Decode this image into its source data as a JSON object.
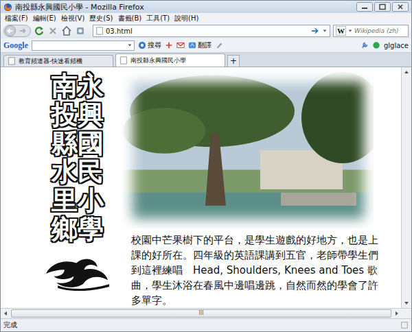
{
  "window": {
    "title": "南投縣永興國民小學 - Mozilla Firefox"
  },
  "menu": [
    "檔案(F)",
    "編輯(E)",
    "檢視(V)",
    "歷史(S)",
    "書籤(B)",
    "工具(T)",
    "說明(H)"
  ],
  "navigation": {
    "address": "03.html",
    "search_engine": "W",
    "search_placeholder": "Wikipedia (zh)"
  },
  "google_toolbar": {
    "logo": "Google",
    "search_button": "搜尋",
    "translate_button": "翻譯",
    "account": "glglace"
  },
  "tabs": [
    {
      "label": "教育頻道器-快速看頻機",
      "selected": false
    },
    {
      "label": "南投縣永興國民小學",
      "selected": true
    }
  ],
  "new_tab": "+",
  "page": {
    "title_columns": [
      "永興國民小學",
      "南投縣水里鄉"
    ],
    "paragraph": "校園中芒果樹下的平台，是學生遊戲的好地方，也是上課的好所在。四年級的英語課講到五官，老師帶學生們到這裡練唱　Head, Shoulders, Knees and Toes 歌曲，學生沐浴在春風中邊唱邊跳，自然而然的學會了許多單字。"
  },
  "scrollbar": {
    "grip": "III"
  },
  "status_bar": "完成"
}
